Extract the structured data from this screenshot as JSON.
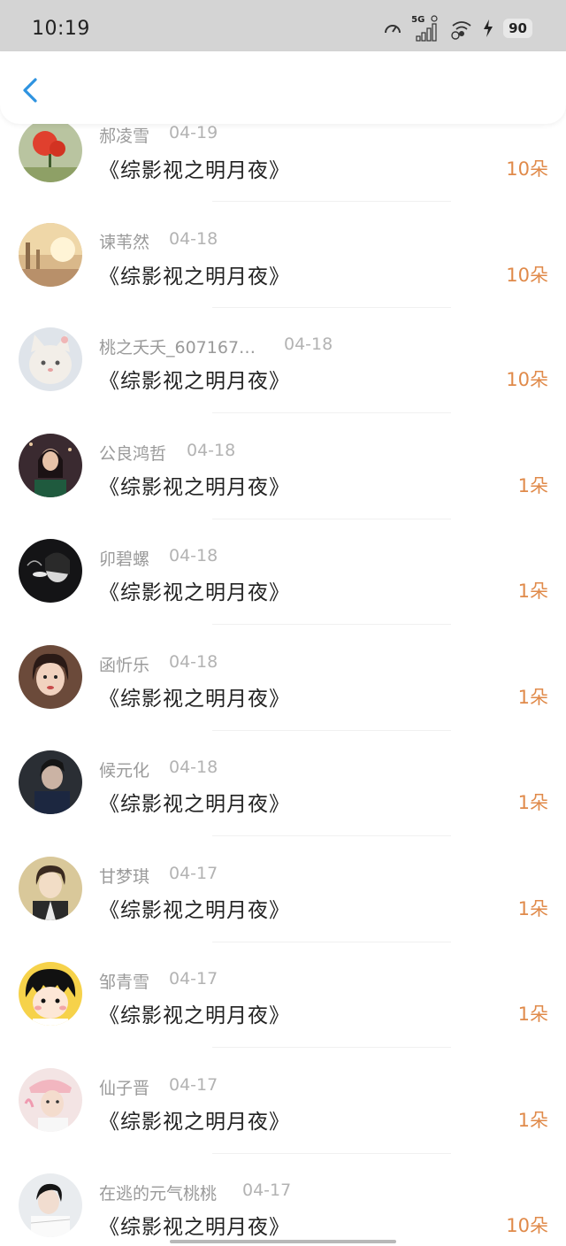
{
  "status_bar": {
    "time": "10:19",
    "network": "5G",
    "battery": "90"
  },
  "header": {
    "back_icon": "chevron-left-icon",
    "accent_color": "#2e93e0"
  },
  "colors": {
    "amount": "#e08a4a",
    "username": "#9a9a9a",
    "date": "#b3b3b3",
    "title": "#222222"
  },
  "records": [
    {
      "user": "郝凌雪",
      "date": "04-19",
      "title": "《综影视之明月夜》",
      "amount": "10朵"
    },
    {
      "user": "谏苇然",
      "date": "04-18",
      "title": "《综影视之明月夜》",
      "amount": "10朵"
    },
    {
      "user": "桃之夭夭_607167…",
      "date": "04-18",
      "title": "《综影视之明月夜》",
      "amount": "10朵"
    },
    {
      "user": "公良鸿哲",
      "date": "04-18",
      "title": "《综影视之明月夜》",
      "amount": "1朵"
    },
    {
      "user": "卯碧螺",
      "date": "04-18",
      "title": "《综影视之明月夜》",
      "amount": "1朵"
    },
    {
      "user": "函忻乐",
      "date": "04-18",
      "title": "《综影视之明月夜》",
      "amount": "1朵"
    },
    {
      "user": "候元化",
      "date": "04-18",
      "title": "《综影视之明月夜》",
      "amount": "1朵"
    },
    {
      "user": "甘梦琪",
      "date": "04-17",
      "title": "《综影视之明月夜》",
      "amount": "1朵"
    },
    {
      "user": "邹青雪",
      "date": "04-17",
      "title": "《综影视之明月夜》",
      "amount": "1朵"
    },
    {
      "user": "仙子晋",
      "date": "04-17",
      "title": "《综影视之明月夜》",
      "amount": "1朵"
    },
    {
      "user": "在逃的元气桃桃",
      "date": "04-17",
      "title": "《综影视之明月夜》",
      "amount": "10朵"
    }
  ]
}
